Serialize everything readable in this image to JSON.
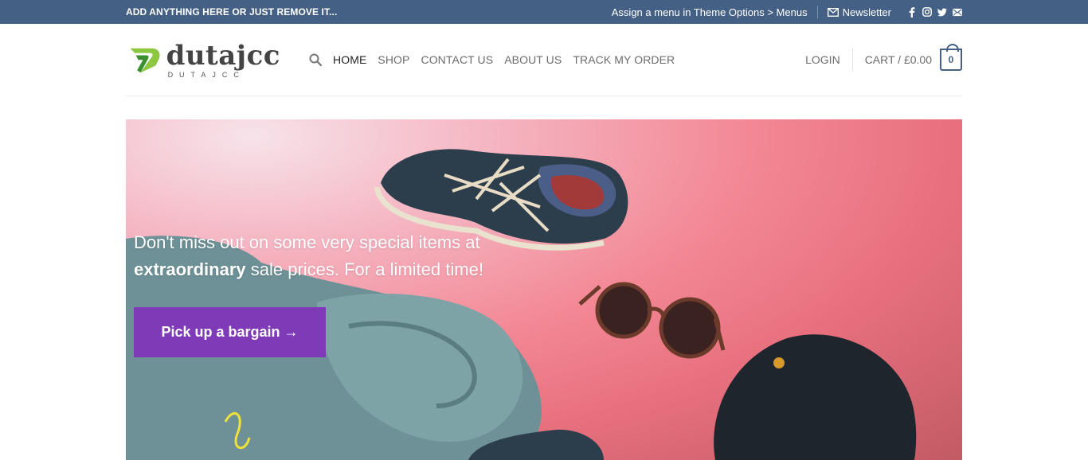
{
  "topbar": {
    "left_text": "ADD ANYTHING HERE OR JUST REMOVE IT...",
    "menu_notice": "Assign a menu in Theme Options > Menus",
    "newsletter_label": "Newsletter",
    "social_icons": [
      "facebook-icon",
      "instagram-icon",
      "twitter-icon",
      "email-icon"
    ],
    "background_color": "#446084"
  },
  "logo": {
    "name": "dutajcc",
    "subtitle": "DUTAJCC",
    "mark_colors": [
      "#8dc63f",
      "#3a8f2f"
    ]
  },
  "nav": {
    "items": [
      {
        "label": "HOME",
        "active": true
      },
      {
        "label": "SHOP",
        "active": false
      },
      {
        "label": "CONTACT US",
        "active": false
      },
      {
        "label": "ABOUT US",
        "active": false
      },
      {
        "label": "TRACK MY ORDER",
        "active": false
      }
    ]
  },
  "account": {
    "login_label": "LOGIN",
    "cart_label": "CART / £0.00",
    "cart_count": "0"
  },
  "hero": {
    "line1": "Don't miss out on some very special items at",
    "line2_bold": "extraordinary",
    "line2_rest": " sale prices. For a limited time!",
    "button_label": "Pick up a bargain →",
    "button_color": "#7f3ab8"
  }
}
